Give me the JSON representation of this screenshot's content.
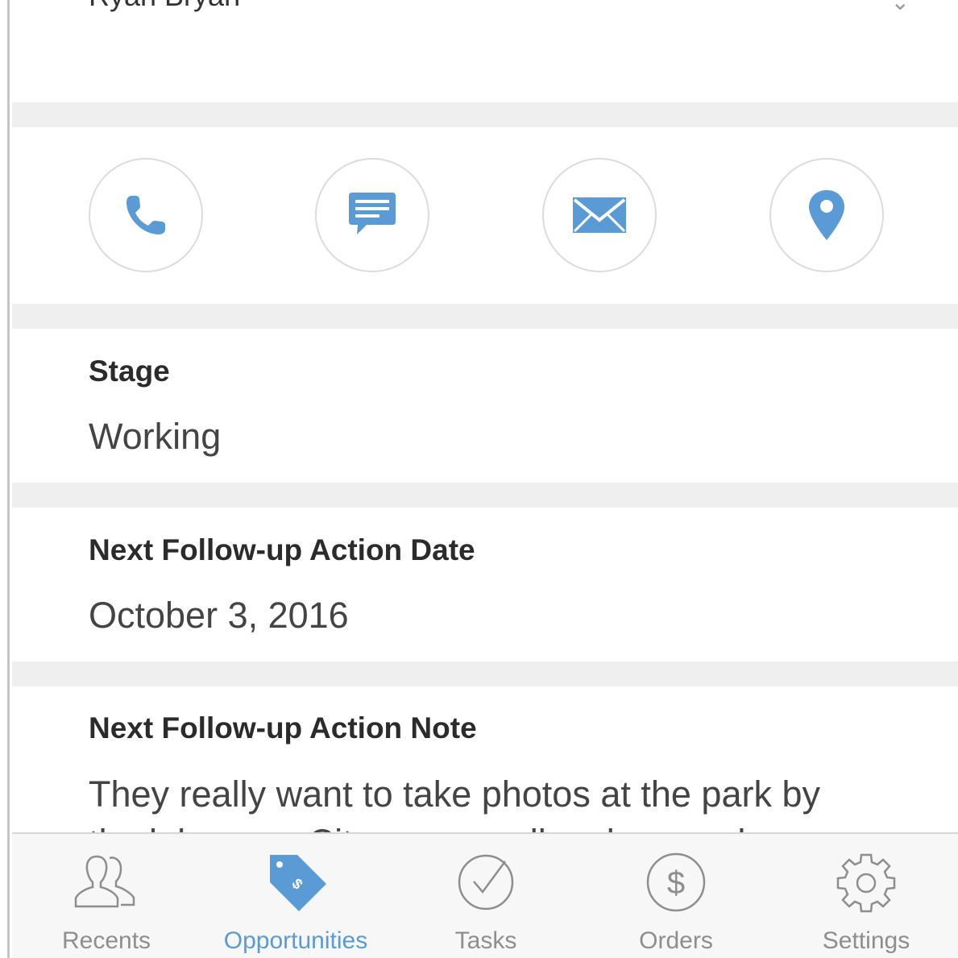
{
  "header": {
    "cut_text": "Ryan Bryan",
    "chevron": "⌄"
  },
  "actions": [
    {
      "name": "call",
      "icon": "phone-icon"
    },
    {
      "name": "message",
      "icon": "message-icon"
    },
    {
      "name": "email",
      "icon": "envelope-icon"
    },
    {
      "name": "location",
      "icon": "map-pin-icon"
    }
  ],
  "fields": {
    "stage": {
      "label": "Stage",
      "value": "Working"
    },
    "next_date": {
      "label": "Next Follow-up Action Date",
      "value": "October 3, 2016"
    },
    "next_note": {
      "label": "Next Follow-up Action Note",
      "value_line1": "They really want to take photos at the park by",
      "value_line2": "the lake near City on a small rock a good"
    }
  },
  "tabbar": {
    "tabs": [
      {
        "label": "Recents",
        "icon": "people-icon",
        "active": false
      },
      {
        "label": "Opportunities",
        "icon": "price-tag-icon",
        "active": true
      },
      {
        "label": "Tasks",
        "icon": "check-circle-icon",
        "active": false
      },
      {
        "label": "Orders",
        "icon": "dollar-circle-icon",
        "active": false
      },
      {
        "label": "Settings",
        "icon": "gear-icon",
        "active": false
      }
    ]
  },
  "colors": {
    "accent": "#5b9bd5",
    "separator": "#efefef",
    "tab_inactive": "#8e8e8e"
  }
}
